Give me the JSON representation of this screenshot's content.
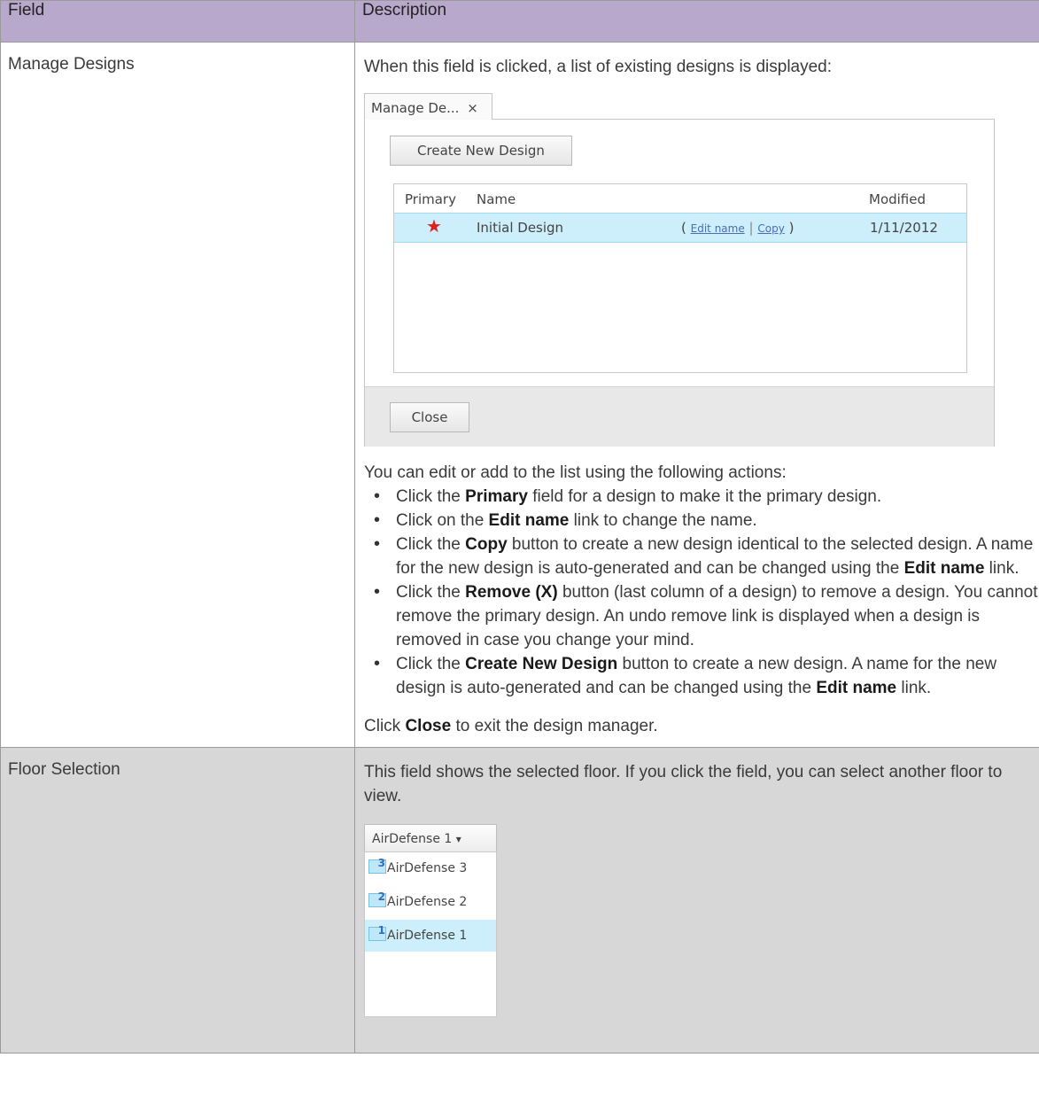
{
  "table": {
    "headers": {
      "field": "Field",
      "description": "Description"
    }
  },
  "manage_designs": {
    "field": "Manage Designs",
    "intro": "When this field is clicked, a list of existing designs is displayed:",
    "screenshot": {
      "tab_label": "Manage De...",
      "tab_close": "×",
      "create_button": "Create New Design",
      "columns": {
        "primary": "Primary",
        "name": "Name",
        "modified": "Modified"
      },
      "rows": [
        {
          "primary_icon": "red-star-icon",
          "primary_glyph": "★",
          "name": "Initial Design",
          "open_paren": "(",
          "edit_link": "Edit name",
          "separator": "|",
          "copy_link": "Copy",
          "close_paren": ")",
          "modified": "1/11/2012"
        }
      ],
      "close_button": "Close"
    },
    "actions_intro": "You can edit or add to the list using the following actions:",
    "actions": [
      {
        "pre": "Click the ",
        "b1": "Primary",
        "mid": " field for a design to make it the primary design.",
        "b2": "",
        "post": ""
      },
      {
        "pre": "Click on the ",
        "b1": "Edit name",
        "mid": " link to change the name.",
        "b2": "",
        "post": ""
      },
      {
        "pre": "Click the ",
        "b1": "Copy",
        "mid": " button to create a new design identical to the selected design. A name for the new design is auto-generated and can be changed using the ",
        "b2": "Edit name",
        "post": " link."
      },
      {
        "pre": "Click the ",
        "b1": "Remove (X)",
        "mid": " button (last column of a design) to remove a design. You cannot remove the primary design. An undo remove link is displayed when a design is removed in case you change your mind.",
        "b2": "",
        "post": ""
      },
      {
        "pre": "Click the ",
        "b1": "Create New Design",
        "mid": " button to create a new design. A name for the new design is auto-generated and can be changed using the ",
        "b2": "Edit name",
        "post": " link."
      }
    ],
    "closing": {
      "pre": "Click ",
      "bold": "Close",
      "post": " to exit the design manager."
    }
  },
  "floor_selection": {
    "field": "Floor Selection",
    "intro": "This field shows the selected floor. If you click the field, you can select another floor to view.",
    "screenshot": {
      "dropdown_value": "AirDefense 1",
      "dropdown_arrow": "▾",
      "items": [
        {
          "icon": "floor-3-icon",
          "number": "3",
          "label": "AirDefense 3",
          "selected": false
        },
        {
          "icon": "floor-2-icon",
          "number": "2",
          "label": "AirDefense 2",
          "selected": false
        },
        {
          "icon": "floor-1-icon",
          "number": "1",
          "label": "AirDefense 1",
          "selected": true
        }
      ]
    }
  },
  "colors": {
    "header_bg": "#b8a8cc",
    "shaded_row_bg": "#d7d7d7",
    "selected_row_bg": "#cdeefb",
    "star": "#e02020",
    "link": "#4a6db5"
  }
}
